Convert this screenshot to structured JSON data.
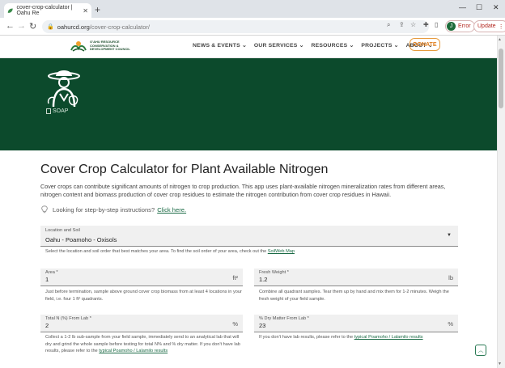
{
  "browser": {
    "tab_title": "cover-crop-calculator | Oahu Re",
    "new_tab": "+",
    "url_domain": "oahurcd.org",
    "url_path": "/cover-crop-calculator/",
    "profile_initial": "J",
    "profile_status": "Error",
    "update_label": "Update"
  },
  "header": {
    "logo_text": "O'AHU RESOURCE CONSERVATION & DEVELOPMENT COUNCIL",
    "nav": [
      "NEWS & EVENTS ⌄",
      "OUR SERVICES ⌄",
      "RESOURCES ⌄",
      "PROJECTS ⌄",
      "ABOUT ⌄"
    ],
    "donate": "DONATE"
  },
  "hero": {
    "image_alt": "SOAP"
  },
  "main": {
    "title": "Cover Crop Calculator for Plant Available Nitrogen",
    "intro": "Cover crops can contribute significant amounts of nitrogen to crop production. This app uses plant-available nitrogen mineralization rates from different areas, nitrogen content and biomass production of cover crop residues to estimate the nitrogen contribution from cover crop residues in Hawaii.",
    "help_text": "Looking for step-by-step instructions?",
    "help_link": "Click here.",
    "location": {
      "label": "Location and Soil",
      "value": "Oahu - Poamoho - Oxisols",
      "helper": "Select the location and soil order that best matches your area. To find the soil order of your area, check out the",
      "helper_link": "SoilWeb Map"
    },
    "area": {
      "label": "Area *",
      "value": "1",
      "unit": "ft²",
      "helper": "Just before termination, sample above ground cover crop biomass from at least 4 locations in your field, i.e. four 1 ft² quadrants."
    },
    "fresh_weight": {
      "label": "Fresh Weight *",
      "value": "1.2",
      "unit": "lb",
      "helper": "Combine all quadrant samples. Tear them up by hand and mix them for 1-2 minutes. Weigh the fresh weight of your field sample."
    },
    "total_n": {
      "label": "Total N (%) From Lab *",
      "value": "2",
      "unit": "%",
      "helper": "Collect a 1-2 lb sub-sample from your field sample, immediately send to an analytical lab that will dry and grind the whole sample before testing for total N% and % dry matter. If you don't have lab results, please refer to the",
      "helper_link": "typical Poamoho / Lalamilo results"
    },
    "dry_matter": {
      "label": "% Dry Matter From Lab *",
      "value": "23",
      "unit": "%",
      "helper": "If you don't have lab results, please refer to the",
      "helper_link": "typical Poamoho / Lalamilo results"
    }
  },
  "colors": {
    "hero_green": "#0c4a2c",
    "donate_orange": "#e07f1f",
    "link_green": "#1a6a45"
  }
}
